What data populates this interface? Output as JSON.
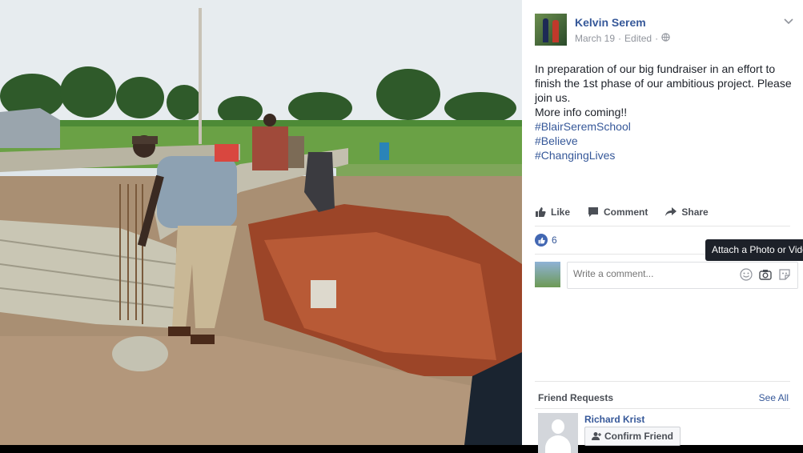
{
  "post": {
    "author": "Kelvin Serem",
    "date": "March 19",
    "edited": "Edited",
    "privacy_icon": "globe-icon",
    "text_lines": [
      "In preparation of our big fundraiser in an effort to",
      "finish the 1st phase of our ambitious project. Please",
      "join us.",
      "More info coming!!"
    ],
    "hashtags": [
      "#BlairSeremSchool",
      "#Believe",
      "#ChangingLives"
    ]
  },
  "actions": {
    "like": "Like",
    "comment": "Comment",
    "share": "Share"
  },
  "reactions": {
    "count": "6"
  },
  "comment": {
    "placeholder": "Write a comment..."
  },
  "tooltip": {
    "text": "Attach a Photo or Video"
  },
  "friend_requests": {
    "title": "Friend Requests",
    "see_all": "See All",
    "name": "Richard Krist",
    "confirm": "Confirm Friend"
  },
  "colors": {
    "link": "#365899",
    "text": "#1d2129",
    "muted": "#90949c",
    "like": "#4267b2"
  }
}
